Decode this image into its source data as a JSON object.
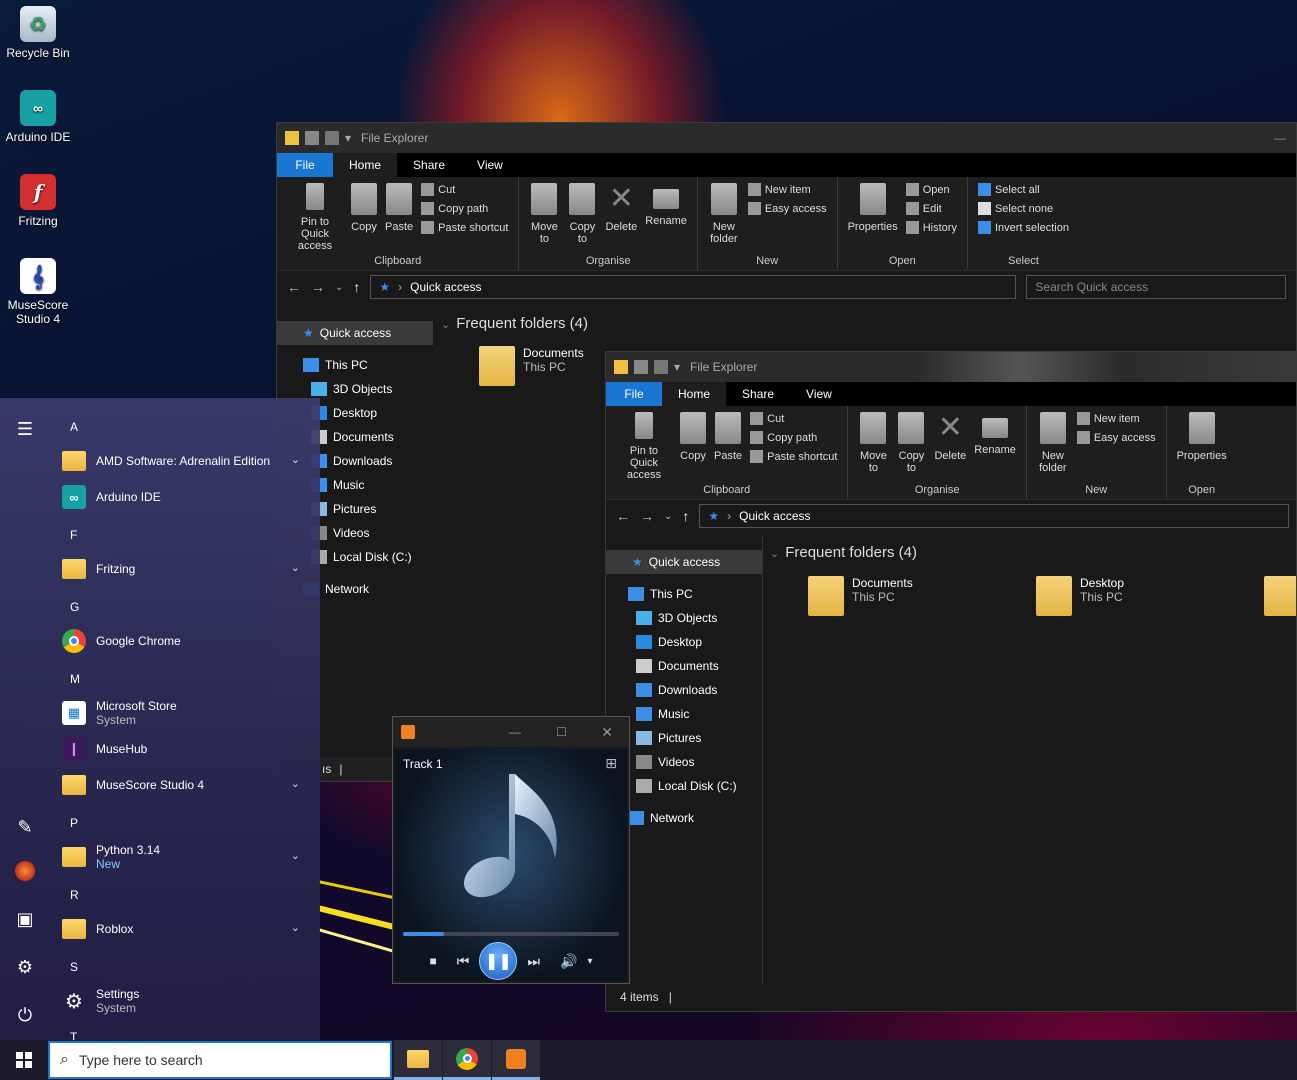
{
  "desktop": {
    "icons": [
      {
        "label": "Recycle Bin",
        "icon": "recycle-bin-icon"
      },
      {
        "label": "Arduino IDE",
        "icon": "arduino-icon"
      },
      {
        "label": "Fritzing",
        "icon": "fritzing-icon"
      },
      {
        "label": "MuseScore Studio 4",
        "icon": "musescore-icon"
      }
    ]
  },
  "explorer_back": {
    "title": "File Explorer",
    "tabs": [
      "File",
      "Home",
      "Share",
      "View"
    ],
    "clipboard": {
      "pin": "Pin to Quick access",
      "copy": "Copy",
      "paste": "Paste",
      "cut": "Cut",
      "copy_path": "Copy path",
      "paste_shortcut": "Paste shortcut",
      "group": "Clipboard"
    },
    "organise": {
      "move": "Move to",
      "copy": "Copy to",
      "delete": "Delete",
      "rename": "Rename",
      "group": "Organise"
    },
    "new": {
      "new_folder": "New folder",
      "new_item": "New item",
      "easy_access": "Easy access",
      "group": "New"
    },
    "open": {
      "properties": "Properties",
      "open": "Open",
      "edit": "Edit",
      "history": "History",
      "group": "Open"
    },
    "select": {
      "all": "Select all",
      "none": "Select none",
      "invert": "Invert selection",
      "group": "Select"
    },
    "address": "Quick access",
    "search_placeholder": "Search Quick access",
    "nav": [
      "Quick access",
      "This PC",
      "3D Objects",
      "Desktop",
      "Documents",
      "Downloads",
      "Music",
      "Pictures",
      "Videos",
      "Local Disk (C:)",
      "Network"
    ],
    "section": "Frequent folders (4)",
    "folders": [
      {
        "name": "Documents",
        "sub": "This PC"
      }
    ]
  },
  "explorer_front": {
    "title": "File Explorer",
    "tabs": [
      "File",
      "Home",
      "Share",
      "View"
    ],
    "clipboard": {
      "pin": "Pin to Quick access",
      "copy": "Copy",
      "paste": "Paste",
      "cut": "Cut",
      "copy_path": "Copy path",
      "paste_shortcut": "Paste shortcut",
      "group": "Clipboard"
    },
    "organise": {
      "move": "Move to",
      "copy": "Copy to",
      "delete": "Delete",
      "rename": "Rename",
      "group": "Organise"
    },
    "new": {
      "new_folder": "New folder",
      "new_item": "New item",
      "easy_access": "Easy access",
      "group": "New"
    },
    "open": {
      "properties": "Properties",
      "group": "Open"
    },
    "address": "Quick access",
    "nav": [
      "Quick access",
      "This PC",
      "3D Objects",
      "Desktop",
      "Documents",
      "Downloads",
      "Music",
      "Pictures",
      "Videos",
      "Local Disk (C:)",
      "Network"
    ],
    "section": "Frequent folders (4)",
    "folders": [
      {
        "name": "Documents",
        "sub": "This PC"
      },
      {
        "name": "Desktop",
        "sub": "This PC"
      }
    ],
    "status": "4 items"
  },
  "start_menu": {
    "letters": [
      "A",
      "F",
      "G",
      "M",
      "P",
      "R",
      "S",
      "T"
    ],
    "apps": [
      {
        "name": "AMD Software: Adrenalin Edition",
        "sub": ""
      },
      {
        "name": "Arduino IDE",
        "sub": ""
      },
      {
        "name": "Fritzing",
        "sub": ""
      },
      {
        "name": "Google Chrome",
        "sub": ""
      },
      {
        "name": "Microsoft Store",
        "sub": "System"
      },
      {
        "name": "MuseHub",
        "sub": ""
      },
      {
        "name": "MuseScore Studio 4",
        "sub": ""
      },
      {
        "name": "Python 3.14",
        "sub": "New"
      },
      {
        "name": "Roblox",
        "sub": ""
      },
      {
        "name": "Settings",
        "sub": "System"
      }
    ]
  },
  "media_player": {
    "track": "Track 1",
    "progress": 0.19
  },
  "background_status_fragment": "ıs",
  "taskbar": {
    "search_placeholder": "Type here to search",
    "apps": [
      "file-explorer-icon",
      "chrome-icon",
      "media-player-icon"
    ]
  }
}
